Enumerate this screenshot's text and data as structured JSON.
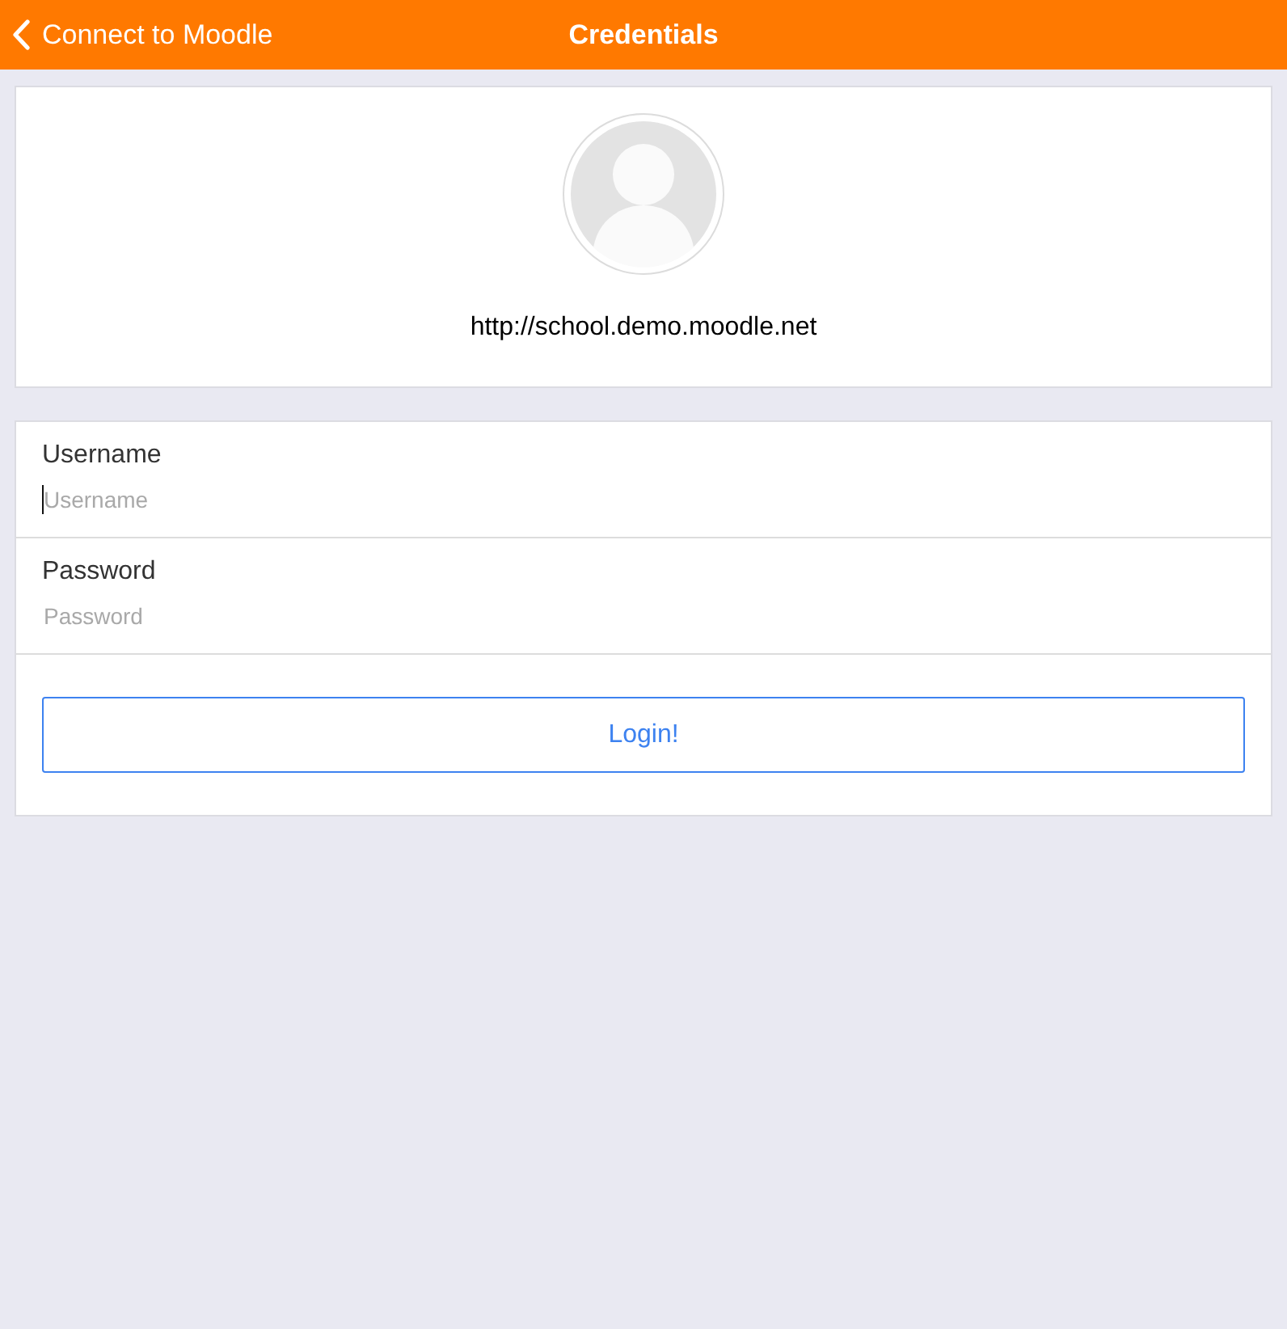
{
  "header": {
    "back_label": "Connect to Moodle",
    "title": "Credentials"
  },
  "site": {
    "url": "http://school.demo.moodle.net"
  },
  "fields": [
    {
      "label": "Username",
      "placeholder": "Username",
      "focused": true
    },
    {
      "label": "Password",
      "placeholder": "Password",
      "focused": false
    }
  ],
  "login_button": {
    "label": "Login!"
  }
}
